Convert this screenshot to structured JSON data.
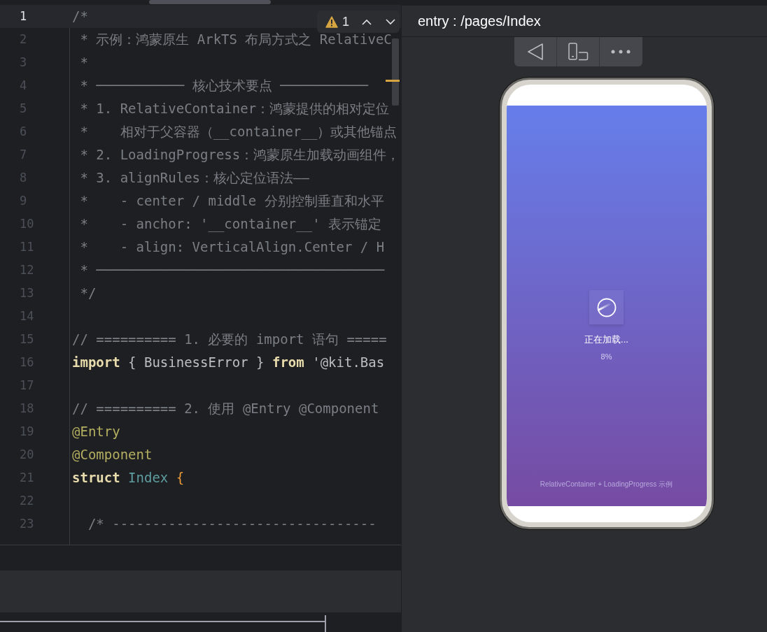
{
  "editor": {
    "warning": {
      "count": "1"
    },
    "lines": [
      {
        "number": "1",
        "active": true,
        "tokens": [
          {
            "kind": "comment",
            "text": "/*"
          }
        ]
      },
      {
        "number": "2",
        "active": false,
        "tokens": [
          {
            "kind": "comment",
            "text": " * 示例：鸿蒙原生 ArkTS 布局方式之 RelativeC"
          }
        ]
      },
      {
        "number": "3",
        "active": false,
        "tokens": [
          {
            "kind": "comment",
            "text": " *"
          }
        ]
      },
      {
        "number": "4",
        "active": false,
        "tokens": [
          {
            "kind": "comment",
            "text": " * ─────────── 核心技术要点 ───────────"
          }
        ]
      },
      {
        "number": "5",
        "active": false,
        "tokens": [
          {
            "kind": "comment",
            "text": " * 1. RelativeContainer：鸿蒙提供的相对定位"
          }
        ]
      },
      {
        "number": "6",
        "active": false,
        "tokens": [
          {
            "kind": "comment",
            "text": " *    相对于父容器（__container__）或其他锚点"
          }
        ]
      },
      {
        "number": "7",
        "active": false,
        "tokens": [
          {
            "kind": "comment",
            "text": " * 2. LoadingProgress：鸿蒙原生加载动画组件，"
          }
        ]
      },
      {
        "number": "8",
        "active": false,
        "tokens": [
          {
            "kind": "comment",
            "text": " * 3. alignRules：核心定位语法——"
          }
        ]
      },
      {
        "number": "9",
        "active": false,
        "tokens": [
          {
            "kind": "comment",
            "text": " *    - center / middle 分别控制垂直和水平"
          }
        ]
      },
      {
        "number": "10",
        "active": false,
        "tokens": [
          {
            "kind": "comment",
            "text": " *    - anchor: '__container__' 表示锚定"
          }
        ]
      },
      {
        "number": "11",
        "active": false,
        "tokens": [
          {
            "kind": "comment",
            "text": " *    - align: VerticalAlign.Center / H"
          }
        ]
      },
      {
        "number": "12",
        "active": false,
        "tokens": [
          {
            "kind": "comment",
            "text": " * ────────────────────────────────────"
          }
        ]
      },
      {
        "number": "13",
        "active": false,
        "tokens": [
          {
            "kind": "comment",
            "text": " */"
          }
        ]
      },
      {
        "number": "14",
        "active": false
      },
      {
        "number": "15",
        "active": false,
        "tokens": [
          {
            "kind": "comment",
            "text": "// ========== 1. 必要的 import 语句 ====="
          }
        ]
      },
      {
        "number": "16",
        "active": false,
        "tokens": [
          {
            "kind": "keyword",
            "text": "import"
          },
          {
            "kind": "plain",
            "text": " { BusinessError } "
          },
          {
            "kind": "keyword",
            "text": "from"
          },
          {
            "kind": "string",
            "text": " '@kit.Bas"
          }
        ]
      },
      {
        "number": "17",
        "active": false
      },
      {
        "number": "18",
        "active": false,
        "tokens": [
          {
            "kind": "comment",
            "text": "// ========== 2. 使用 @Entry @Component"
          }
        ]
      },
      {
        "number": "19",
        "active": false,
        "tokens": [
          {
            "kind": "annotation",
            "text": "@Entry"
          }
        ]
      },
      {
        "number": "20",
        "active": false,
        "tokens": [
          {
            "kind": "annotation",
            "text": "@Component"
          }
        ]
      },
      {
        "number": "21",
        "active": false,
        "tokens": [
          {
            "kind": "keyword",
            "text": "struct "
          },
          {
            "kind": "type",
            "text": "Index "
          },
          {
            "kind": "brace",
            "text": "{"
          }
        ]
      },
      {
        "number": "22",
        "active": false
      },
      {
        "number": "23",
        "active": false,
        "tokens": [
          {
            "kind": "comment",
            "text": "  /* ---------------------------------"
          }
        ]
      }
    ]
  },
  "preview": {
    "title": "entry : /pages/Index",
    "app": {
      "loading_text": "正在加载...",
      "percent": "8%",
      "footer": "RelativeContainer + LoadingProgress 示例"
    }
  }
}
